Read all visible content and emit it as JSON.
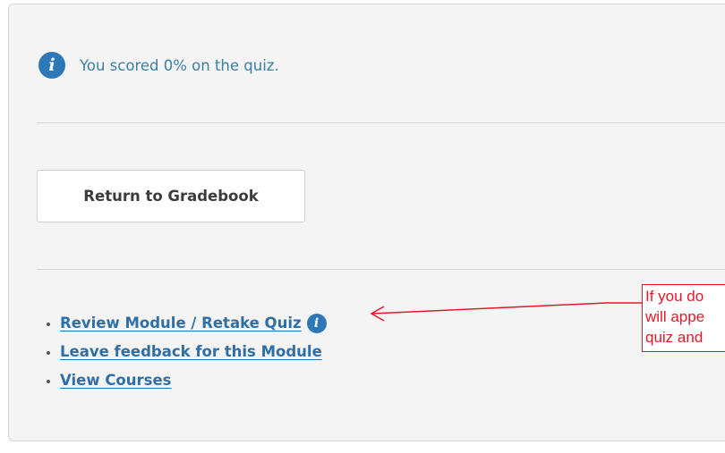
{
  "result": {
    "icon": "info-icon",
    "message": "You scored 0% on the quiz."
  },
  "actions": {
    "return_label": "Return to Gradebook"
  },
  "links": [
    {
      "label": "Review Module / Retake Quiz",
      "has_info_icon": true
    },
    {
      "label": "Leave feedback for this Module",
      "has_info_icon": false
    },
    {
      "label": "View Courses",
      "has_info_icon": false
    }
  ],
  "annotation": {
    "text": "If you do\nwill appe\nquiz and",
    "color": "#e01a2a"
  },
  "colors": {
    "accent": "#2e78b8",
    "link": "#2f6fa6",
    "annotation": "#e01a2a"
  }
}
